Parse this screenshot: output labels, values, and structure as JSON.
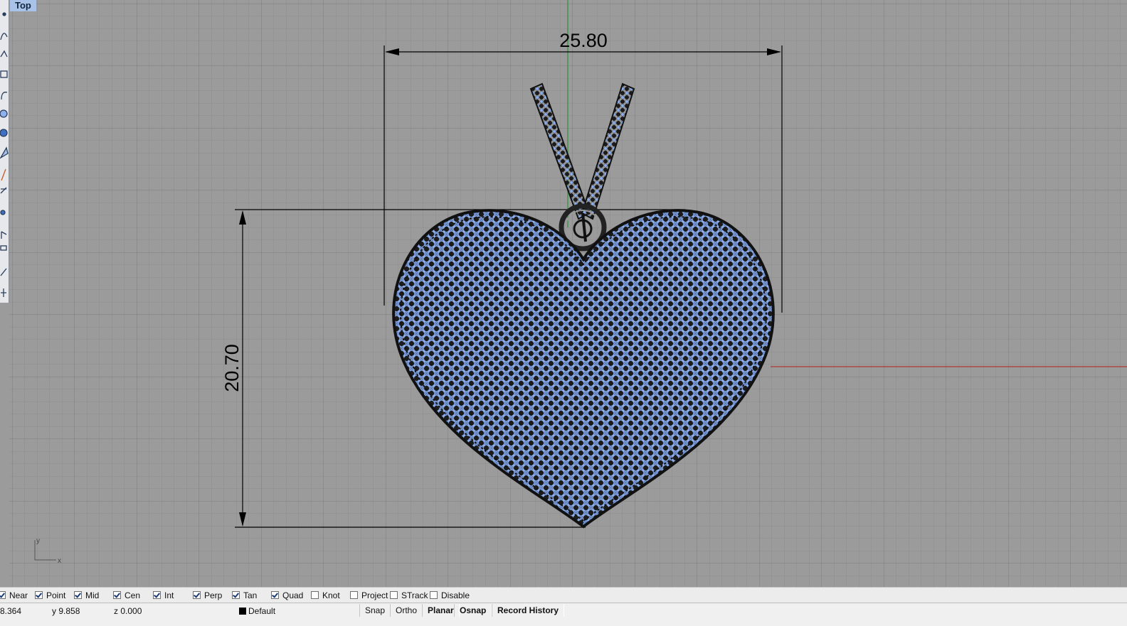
{
  "viewport": {
    "title": "Top",
    "dimension_horizontal": "25.80",
    "dimension_vertical": "20.70",
    "axis_labels": {
      "y": "y",
      "x": "x"
    },
    "colors": {
      "background": "#9b9b9b",
      "grid_minor": "#8e8e8e",
      "grid_major": "#7d7d7d",
      "y_axis": "#2f8f3a",
      "x_axis": "#b03a30",
      "gem_fill": "#8fb0ee",
      "prong": "#1b1b1b"
    }
  },
  "toolbar": {
    "icons": [
      "point-icon",
      "curve-icon",
      "polyline-icon",
      "rectangle-icon",
      "arc-icon",
      "sphere-icon",
      "solid-icon",
      "surface-icon",
      "transform-icon",
      "dimension-icon",
      "mesh-icon",
      "render-icon",
      "annotate-icon",
      "analyze-icon",
      "more-icon"
    ]
  },
  "osnap": {
    "items": [
      {
        "label": "Near",
        "checked": true
      },
      {
        "label": "Point",
        "checked": true
      },
      {
        "label": "Mid",
        "checked": true
      },
      {
        "label": "Cen",
        "checked": true
      },
      {
        "label": "Int",
        "checked": true
      },
      {
        "label": "Perp",
        "checked": true
      },
      {
        "label": "Tan",
        "checked": true
      },
      {
        "label": "Quad",
        "checked": true
      },
      {
        "label": "Knot",
        "checked": false
      },
      {
        "label": "Project",
        "checked": false
      },
      {
        "label": "STrack",
        "checked": false
      },
      {
        "label": "Disable",
        "checked": false
      }
    ]
  },
  "status": {
    "x": "8.364",
    "y": "y 9.858",
    "z": "z 0.000",
    "layer": "Default",
    "panes": [
      {
        "label": "Snap",
        "bold": false
      },
      {
        "label": "Ortho",
        "bold": false
      },
      {
        "label": "Planar",
        "bold": true
      },
      {
        "label": "Osnap",
        "bold": true
      },
      {
        "label": "Record History",
        "bold": true
      }
    ]
  }
}
